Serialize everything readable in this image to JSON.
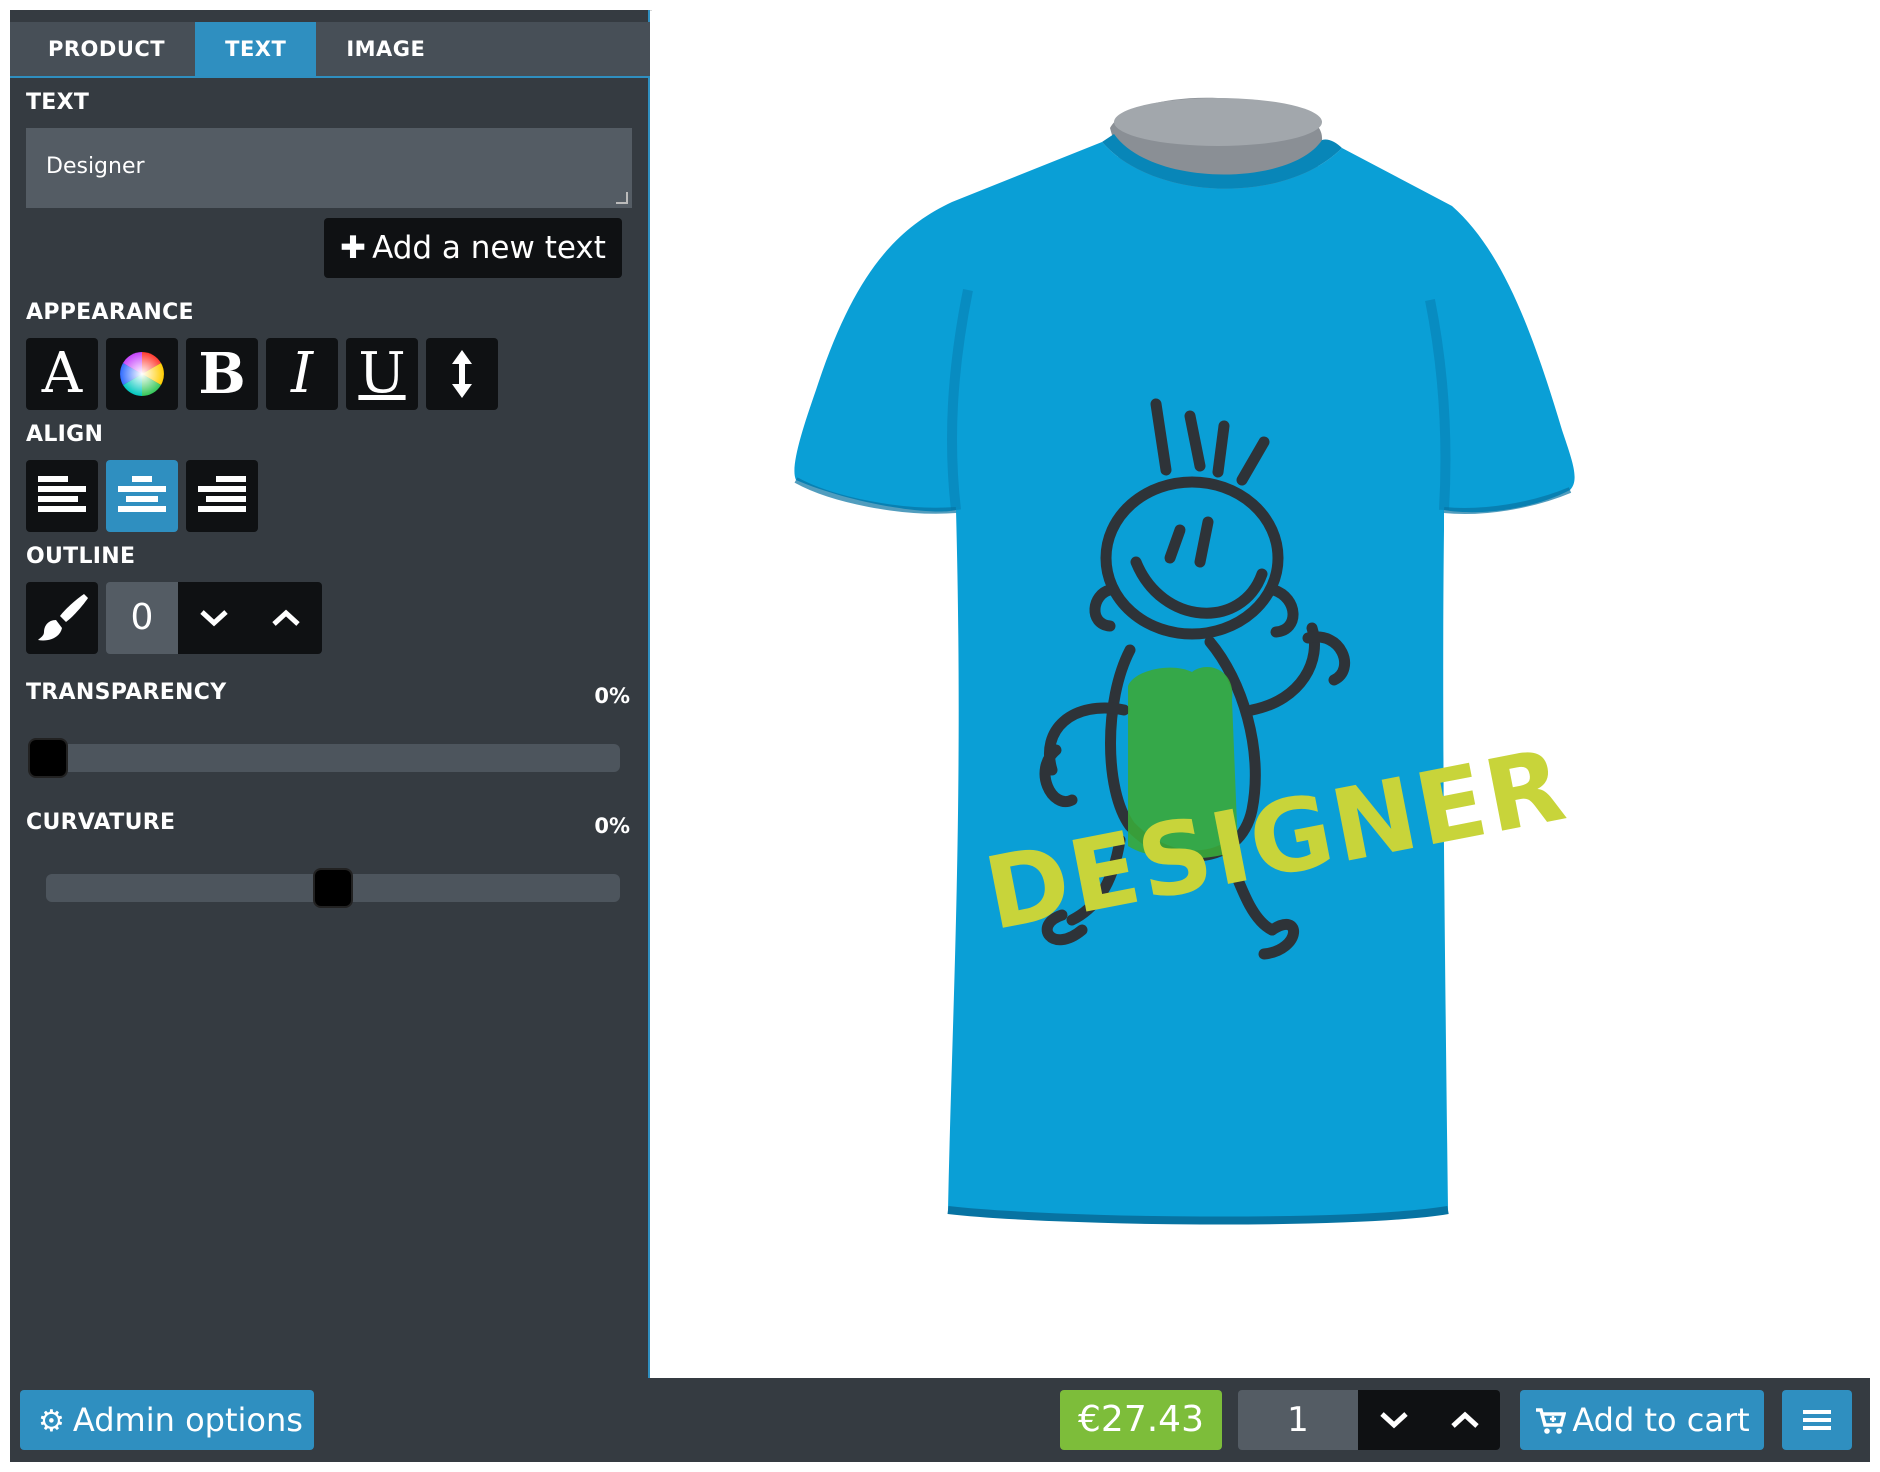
{
  "tabs": [
    {
      "label": "PRODUCT",
      "active": false
    },
    {
      "label": "TEXT",
      "active": true
    },
    {
      "label": "IMAGE",
      "active": false
    }
  ],
  "text_section": {
    "label": "TEXT",
    "value": "Designer",
    "add_button": "Add a new text"
  },
  "appearance": {
    "label": "APPEARANCE",
    "tools": [
      {
        "name": "font-icon",
        "glyph": "A"
      },
      {
        "name": "color-wheel-icon",
        "glyph": ""
      },
      {
        "name": "bold-icon",
        "glyph": "B"
      },
      {
        "name": "italic-icon",
        "glyph": "I"
      },
      {
        "name": "underline-icon",
        "glyph": "U"
      },
      {
        "name": "line-height-icon",
        "glyph": ""
      }
    ]
  },
  "align": {
    "label": "ALIGN",
    "options": [
      "left",
      "center",
      "right"
    ],
    "selected": "center"
  },
  "outline": {
    "label": "OUTLINE",
    "value": "0"
  },
  "transparency": {
    "label": "TRANSPARENCY",
    "value": "0%",
    "fraction": 0.0
  },
  "curvature": {
    "label": "CURVATURE",
    "value": "0%",
    "fraction": 0.5
  },
  "preview": {
    "shirt_color": "#0a9fd6",
    "design_text": "DESIGNER",
    "design_text_color": "#c8d43a"
  },
  "bottom": {
    "admin_label": "Admin options",
    "price": "€27.43",
    "quantity": "1",
    "cart_label": "Add to cart"
  },
  "colors": {
    "accent": "#2f8fc0",
    "panel": "#353b41",
    "price_green": "#7dbd3a"
  }
}
